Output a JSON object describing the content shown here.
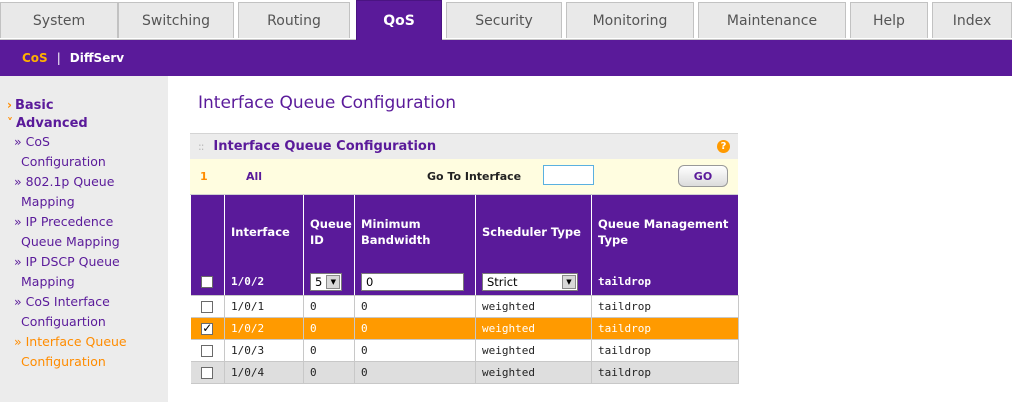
{
  "top_tabs": [
    {
      "label": "System"
    },
    {
      "label": "Switching"
    },
    {
      "label": "Routing"
    },
    {
      "label": "QoS"
    },
    {
      "label": "Security"
    },
    {
      "label": "Monitoring"
    },
    {
      "label": "Maintenance"
    },
    {
      "label": "Help"
    },
    {
      "label": "Index"
    }
  ],
  "active_tab": "QoS",
  "subnav": {
    "cos": "CoS",
    "separator": "|",
    "diffserv": "DiffServ"
  },
  "sidebar": {
    "basic": "Basic",
    "advanced": "Advanced",
    "items": [
      {
        "line1": "» CoS",
        "line2": "Configuration"
      },
      {
        "line1": "» 802.1p Queue",
        "line2": "Mapping"
      },
      {
        "line1": "» IP Precedence",
        "line2": "Queue Mapping"
      },
      {
        "line1": "» IP DSCP Queue",
        "line2": "Mapping"
      },
      {
        "line1": "» CoS Interface",
        "line2": "Configuartion"
      },
      {
        "line1": "» Interface Queue",
        "line2": "Configuration"
      }
    ]
  },
  "page_title": "Interface Queue Configuration",
  "panel": {
    "title": "Interface Queue Configuration",
    "help": "?",
    "page_number": "1",
    "all_link": "All",
    "goto_label": "Go To Interface",
    "goto_value": "",
    "go_button": "GO"
  },
  "table": {
    "headers": {
      "interface": "Interface",
      "queue_id": "Queue ID",
      "min_bandwidth": "Minimum Bandwidth",
      "scheduler_type": "Scheduler Type",
      "queue_mgmt_type": "Queue Management Type"
    },
    "edit_row": {
      "interface": "1/0/2",
      "queue_id": "5",
      "min_bandwidth": "0",
      "scheduler_type": "Strict",
      "queue_mgmt_type": "taildrop"
    },
    "rows": [
      {
        "interface": "1/0/1",
        "queue_id": "0",
        "min_bandwidth": "0",
        "scheduler_type": "weighted",
        "queue_mgmt_type": "taildrop"
      },
      {
        "interface": "1/0/2",
        "queue_id": "0",
        "min_bandwidth": "0",
        "scheduler_type": "weighted",
        "queue_mgmt_type": "taildrop"
      },
      {
        "interface": "1/0/3",
        "queue_id": "0",
        "min_bandwidth": "0",
        "scheduler_type": "weighted",
        "queue_mgmt_type": "taildrop"
      },
      {
        "interface": "1/0/4",
        "queue_id": "0",
        "min_bandwidth": "0",
        "scheduler_type": "weighted",
        "queue_mgmt_type": "taildrop"
      }
    ]
  },
  "colors": {
    "accent_purple": "#5a1a9a",
    "accent_orange": "#ff9a00"
  }
}
